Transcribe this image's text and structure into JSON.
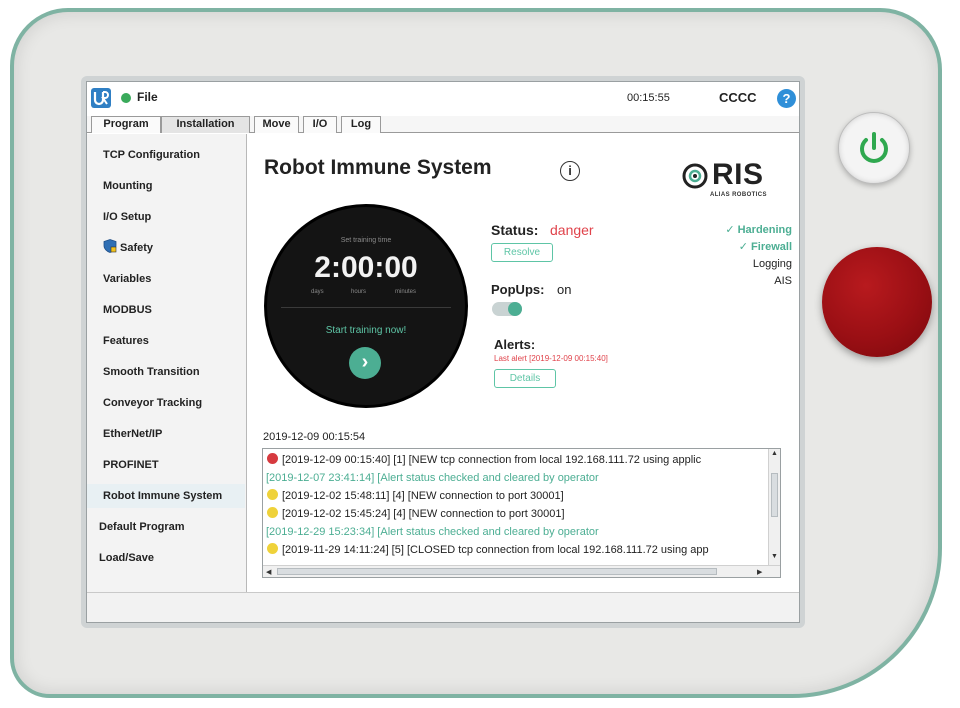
{
  "topbar": {
    "file_label": "File",
    "clock": "00:15:55",
    "user": "CCCC",
    "help_symbol": "?"
  },
  "tabs": [
    {
      "label": "Program"
    },
    {
      "label": "Installation"
    },
    {
      "label": "Move"
    },
    {
      "label": "I/O"
    },
    {
      "label": "Log"
    }
  ],
  "sidebar": {
    "items": [
      {
        "label": "TCP Configuration"
      },
      {
        "label": "Mounting"
      },
      {
        "label": "I/O Setup"
      },
      {
        "label": "Safety"
      },
      {
        "label": "Variables"
      },
      {
        "label": "MODBUS"
      },
      {
        "label": "Features"
      },
      {
        "label": "Smooth Transition"
      },
      {
        "label": "Conveyor Tracking"
      },
      {
        "label": "EtherNet/IP"
      },
      {
        "label": "PROFINET"
      },
      {
        "label": "Robot Immune System"
      },
      {
        "label": "Default Program"
      },
      {
        "label": "Load/Save"
      }
    ]
  },
  "main": {
    "title": "Robot Immune System",
    "info_symbol": "i",
    "logo_text": "RIS",
    "logo_sub": "ALIAS ROBOTICS",
    "timer": {
      "caption": "Set training time",
      "value": "2:00:00",
      "units": [
        "days",
        "hours",
        "minutes"
      ],
      "start_label": "Start training now!",
      "go_symbol": "›"
    },
    "status": {
      "label": "Status:",
      "value": "danger",
      "resolve_label": "Resolve"
    },
    "popups": {
      "label": "PopUps:",
      "value": "on",
      "enabled": true
    },
    "alerts": {
      "label": "Alerts:",
      "last_alert": "Last alert [2019-12-09 00:15:40]",
      "details_label": "Details"
    },
    "checks": [
      {
        "label": "✓ Hardening",
        "state": "ok"
      },
      {
        "label": "✓ Firewall",
        "state": "ok"
      },
      {
        "label": "Logging",
        "state": "plain"
      },
      {
        "label": "AIS",
        "state": "plain"
      }
    ],
    "log_date": "2019-12-09 00:15:54",
    "log": [
      {
        "text": "[2019-12-09 00:15:40] [1] [NEW tcp connection from local 192.168.111.72 using applic",
        "dot": "#d63a3f"
      },
      {
        "text": "[2019-12-07 23:41:14] [Alert status checked and cleared by operator",
        "dot": null
      },
      {
        "text": "[2019-12-02 15:48:11] [4] [NEW connection to port 30001]",
        "dot": "#efd23a"
      },
      {
        "text": "[2019-12-02 15:45:24] [4] [NEW connection to port 30001]",
        "dot": "#efd23a"
      },
      {
        "text": "[2019-12-29 15:23:34] [Alert status checked and cleared by operator",
        "dot": null
      },
      {
        "text": "[2019-11-29 14:11:24] [5] [CLOSED tcp connection from local 192.168.111.72 using app",
        "dot": "#efd23a"
      }
    ]
  },
  "colors": {
    "accent": "#4cae93",
    "danger": "#e0434b",
    "estop": "#9a0f14",
    "power": "#2fa84f"
  }
}
